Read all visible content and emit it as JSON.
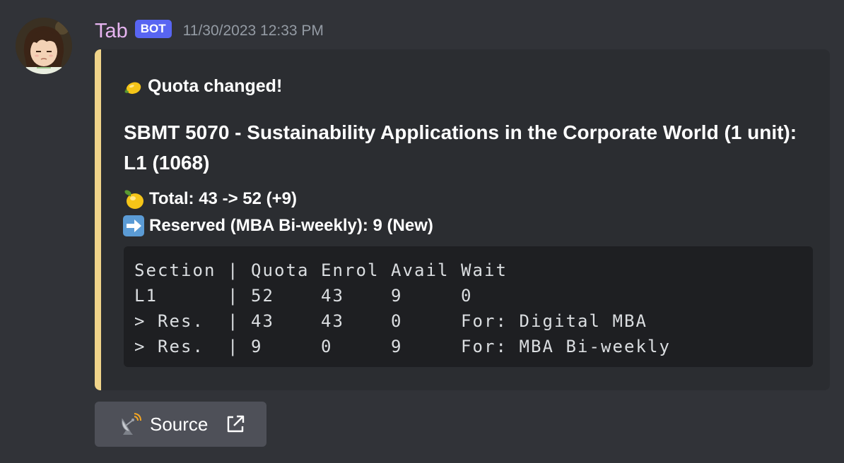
{
  "message": {
    "username": "Tab",
    "badge": "BOT",
    "timestamp": "11/30/2023 12:33 PM",
    "avatar_icon": "anime-girl-avatar-icon"
  },
  "embed": {
    "accent_color": "#f0d48a",
    "title_icon": "lemon-icon",
    "title": "Quota changed!",
    "course_title": "SBMT 5070 - Sustainability Applications in the Corporate World (1 unit): L1 (1068)",
    "total_icon": "lemon-icon",
    "total_line": "Total: 43 -> 52 (+9)",
    "reserved_icon": "right-arrow-icon",
    "reserved_line": "Reserved (MBA Bi-weekly): 9 (New)",
    "code_lines": [
      "Section | Quota Enrol Avail Wait",
      "L1      | 52    43    9     0",
      "> Res.  | 43    43    0     For: Digital MBA",
      "> Res.  | 9     0     9     For: MBA Bi-weekly"
    ]
  },
  "source_button": {
    "icon": "satellite-antenna-icon",
    "label": "Source",
    "link_icon": "external-link-icon"
  }
}
